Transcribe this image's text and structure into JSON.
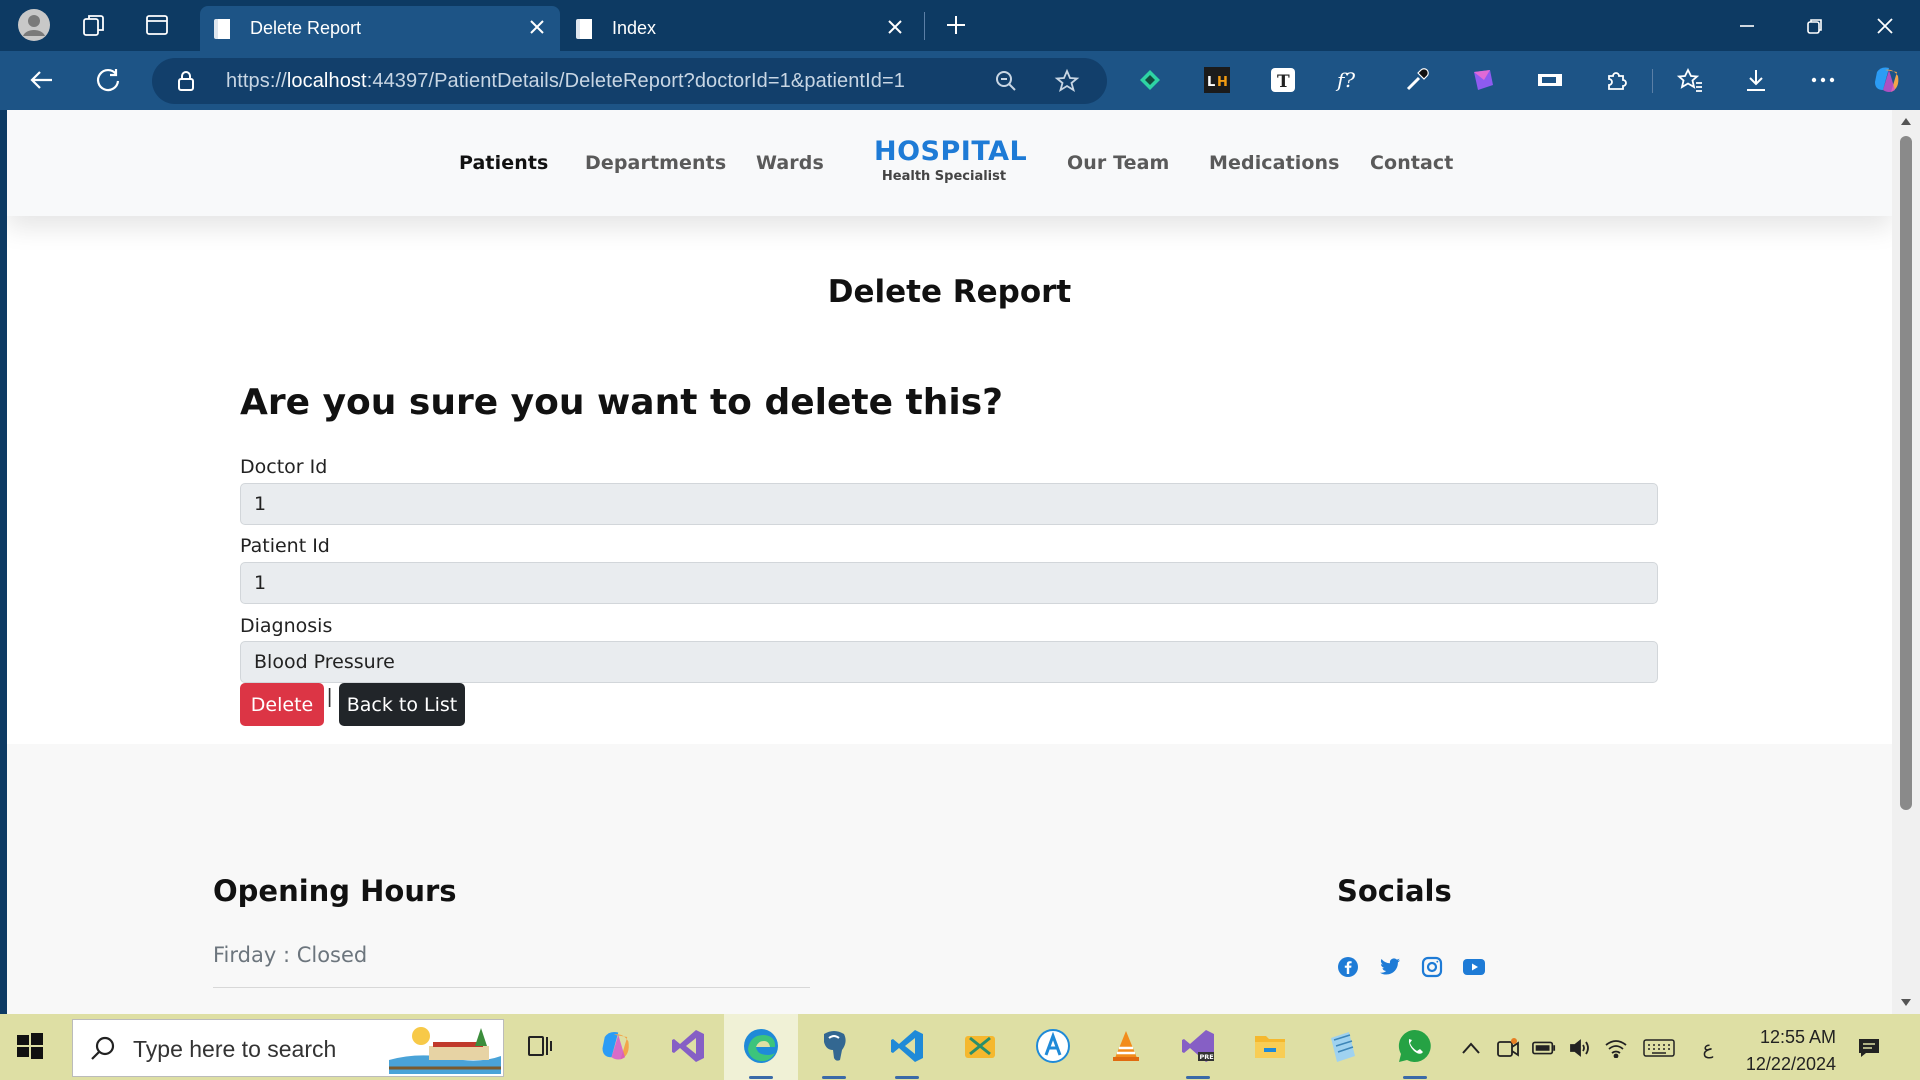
{
  "browser": {
    "tabs": [
      {
        "label": "Delete Report",
        "active": true
      },
      {
        "label": "Index",
        "active": false
      }
    ],
    "url_scheme": "https://",
    "url_host": "localhost",
    "url_rest": ":44397/PatientDetails/DeleteReport?doctorId=1&patientId=1"
  },
  "site": {
    "brand_title": "HOSPITAL",
    "brand_subtitle": "Health Specialist",
    "nav": [
      "Patients",
      "Departments",
      "Wards",
      "Our Team",
      "Medications",
      "Contact"
    ],
    "active_nav": "Patients"
  },
  "page": {
    "title": "Delete Report",
    "confirm_heading": "Are you sure you want to delete this?",
    "fields": [
      {
        "label": "Doctor Id",
        "value": "1"
      },
      {
        "label": "Patient Id",
        "value": "1"
      },
      {
        "label": "Diagnosis",
        "value": "Blood Pressure"
      }
    ],
    "delete_label": "Delete",
    "separator": "|",
    "back_label": "Back to List"
  },
  "footer": {
    "hours_heading": "Opening Hours",
    "hours_line": "Firday : Closed",
    "socials_heading": "Socials",
    "socials": [
      "facebook-icon",
      "twitter-icon",
      "instagram-icon",
      "youtube-icon"
    ],
    "social_color": "#1e7bd6"
  },
  "taskbar": {
    "search_placeholder": "Type here to search",
    "time": "12:55 AM",
    "date": "12/22/2024",
    "lang": "ع"
  },
  "colors": {
    "accent": "#1e7bd6",
    "danger": "#dc3545",
    "dark": "#212529",
    "chrome": "#1d5486",
    "taskbar": "#dedfa4"
  }
}
